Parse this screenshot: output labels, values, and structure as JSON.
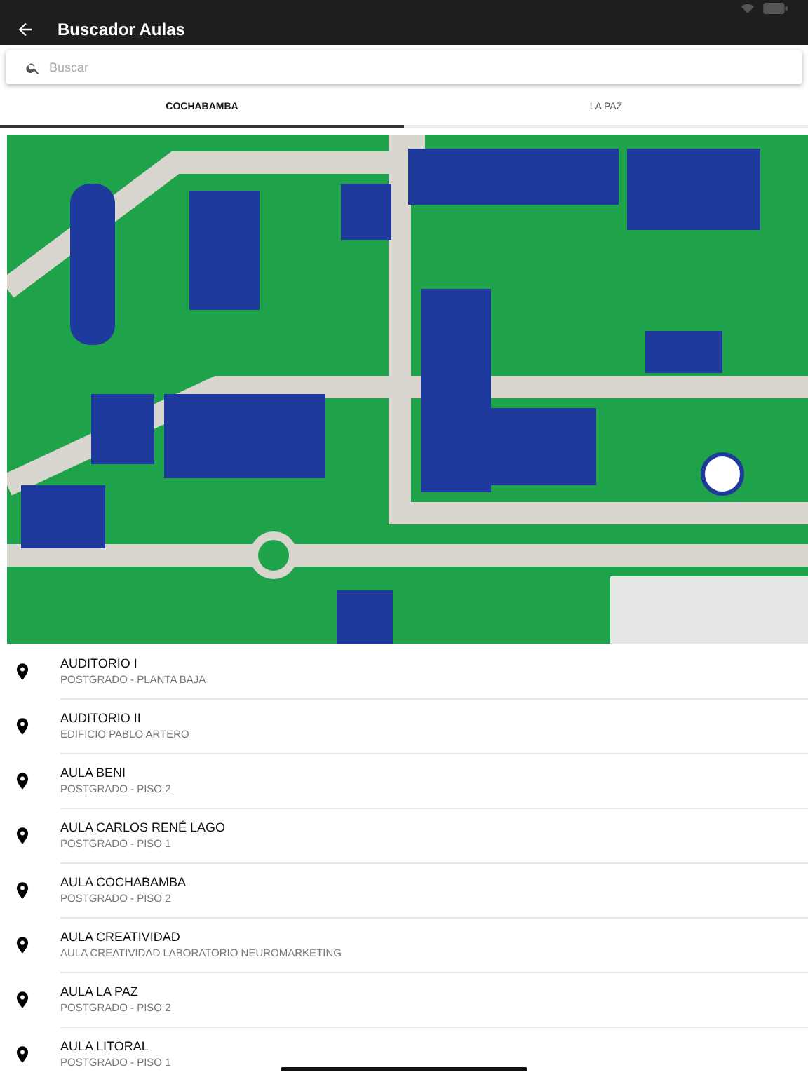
{
  "app_bar": {
    "title": "Buscador Aulas"
  },
  "search": {
    "placeholder": "Buscar"
  },
  "tabs": [
    {
      "label": "COCHABAMBA",
      "selected": true
    },
    {
      "label": "LA PAZ",
      "selected": false
    }
  ],
  "rooms": [
    {
      "name": "AUDITORIO I",
      "location": "POSTGRADO - PLANTA BAJA"
    },
    {
      "name": "AUDITORIO II",
      "location": "EDIFICIO PABLO ARTERO"
    },
    {
      "name": "AULA BENI",
      "location": "POSTGRADO - PISO 2"
    },
    {
      "name": "AULA CARLOS RENÉ LAGO",
      "location": "POSTGRADO - PISO 1"
    },
    {
      "name": "AULA COCHABAMBA",
      "location": "POSTGRADO - PISO 2"
    },
    {
      "name": "AULA CREATIVIDAD",
      "location": "AULA CREATIVIDAD LABORATORIO NEUROMARKETING"
    },
    {
      "name": "AULA LA PAZ",
      "location": "POSTGRADO - PISO 2"
    },
    {
      "name": "AULA LITORAL",
      "location": "POSTGRADO - PISO 1"
    }
  ]
}
